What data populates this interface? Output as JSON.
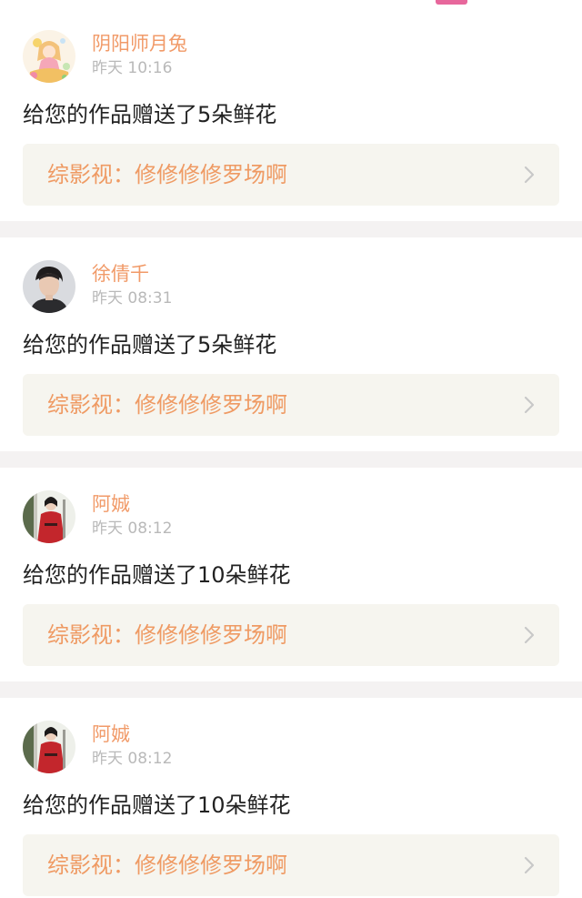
{
  "header": {
    "active_tab_color": "#e7679c"
  },
  "colors": {
    "username": "#f19a68",
    "time": "#b9b9b9",
    "message": "#222222",
    "link_bg": "#f6f5ef",
    "link_text": "#ef9a63",
    "divider": "#f4f2f2"
  },
  "notifications": [
    {
      "avatar_icon": "anime-girl-avatar",
      "username": "阴阳师月兔",
      "time": "昨天 10:16",
      "message": "给您的作品赠送了5朵鲜花",
      "work_title": "综影视：修修修修罗场啊",
      "chevron_icon": "chevron-right-icon"
    },
    {
      "avatar_icon": "man-portrait-avatar",
      "username": "徐倩千",
      "time": "昨天 08:31",
      "message": "给您的作品赠送了5朵鲜花",
      "work_title": "综影视：修修修修罗场啊",
      "chevron_icon": "chevron-right-icon"
    },
    {
      "avatar_icon": "red-robe-figure-avatar",
      "username": "阿娍",
      "time": "昨天 08:12",
      "message": "给您的作品赠送了10朵鲜花",
      "work_title": "综影视：修修修修罗场啊",
      "chevron_icon": "chevron-right-icon"
    },
    {
      "avatar_icon": "red-robe-figure-avatar",
      "username": "阿娍",
      "time": "昨天 08:12",
      "message": "给您的作品赠送了10朵鲜花",
      "work_title": "综影视：修修修修罗场啊",
      "chevron_icon": "chevron-right-icon"
    }
  ]
}
